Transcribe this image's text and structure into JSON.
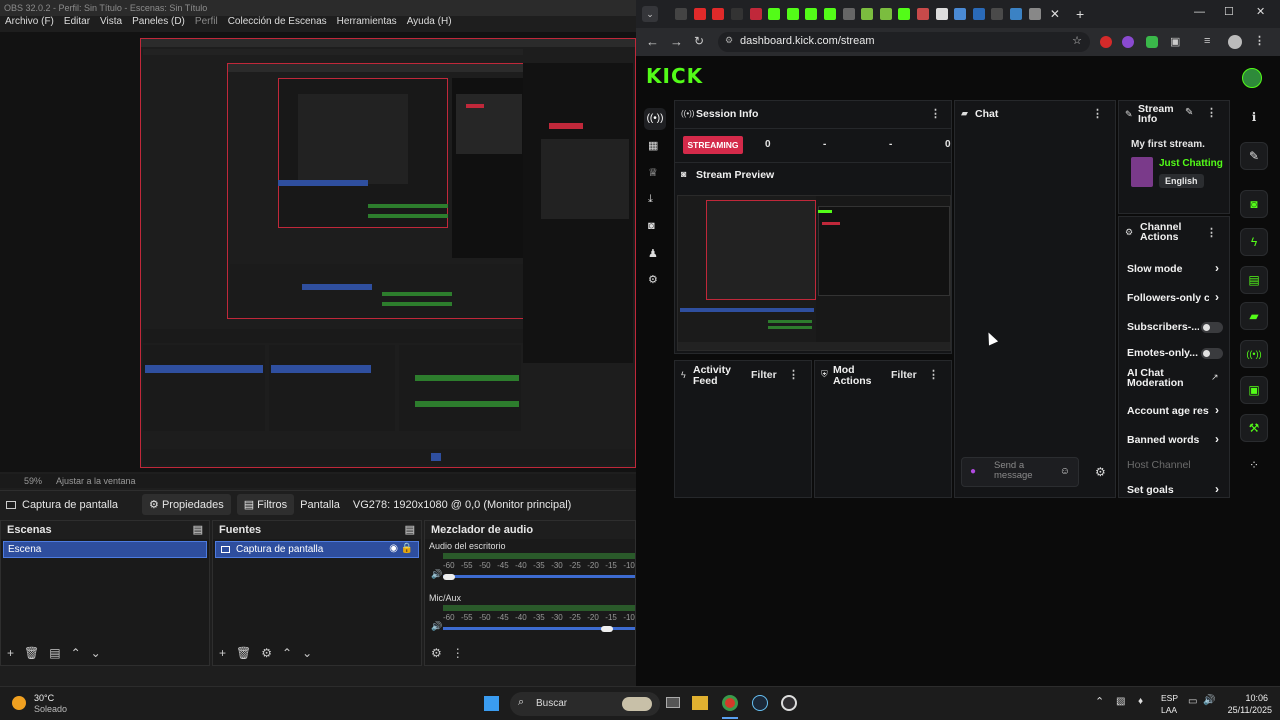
{
  "obs": {
    "title": "OBS 32.0.2 - Perfil: Sin Título - Escenas: Sin Título",
    "menu": [
      "Archivo (F)",
      "Editar",
      "Vista",
      "Paneles (D)",
      "Perfil",
      "Colección de Escenas",
      "Herramientas",
      "Ayuda (H)"
    ],
    "zoom": "59%",
    "fit_label": "Ajustar a la ventana",
    "context": {
      "source_label": "Captura de pantalla",
      "properties": "Propiedades",
      "filters": "Filtros",
      "screen_label": "Pantalla",
      "screen_value": "VG278: 1920x1080 @ 0,0 (Monitor principal)"
    },
    "scenes": {
      "title": "Escenas",
      "items": [
        "Escena"
      ]
    },
    "sources": {
      "title": "Fuentes",
      "items": [
        "Captura de pantalla"
      ]
    },
    "mixer": {
      "title": "Mezclador de audio",
      "channels": [
        {
          "name": "Audio del escritorio",
          "volume": 0.0
        },
        {
          "name": "Mic/Aux",
          "volume": 0.88
        }
      ],
      "ticks": [
        "-60",
        "-55",
        "-50",
        "-45",
        "-40",
        "-35",
        "-30",
        "-25",
        "-20",
        "-15",
        "-10",
        "-5",
        "0"
      ]
    }
  },
  "browser": {
    "url": "dashboard.kick.com/stream",
    "accent": "#53fc18",
    "kick": {
      "logo": "KICK",
      "session": {
        "title": "Session Info",
        "status": "STREAMING",
        "stats": [
          "0",
          "-",
          "-",
          "0"
        ]
      },
      "preview_title": "Stream Preview",
      "activity": {
        "title": "Activity Feed",
        "filter": "Filter"
      },
      "mod": {
        "title": "Mod Actions",
        "filter": "Filter"
      },
      "chat": {
        "title": "Chat",
        "placeholder": "Send a message"
      },
      "stream_info": {
        "title": "Stream Info",
        "stream_title": "My first stream.",
        "category": "Just Chatting",
        "language": "English"
      },
      "channel_actions": {
        "title": "Channel Actions",
        "items": [
          "Slow mode",
          "Followers-only ch",
          "Subscribers-...",
          "Emotes-only...",
          "AI Chat Moderation",
          "Account age restr",
          "Banned words",
          "Host Channel",
          "Set goals"
        ]
      }
    }
  },
  "taskbar": {
    "weather_temp": "30°C",
    "weather_desc": "Soleado",
    "search": "Buscar",
    "lang": "ESP",
    "lang2": "LAA",
    "time": "10:06",
    "date": "25/11/2025"
  }
}
